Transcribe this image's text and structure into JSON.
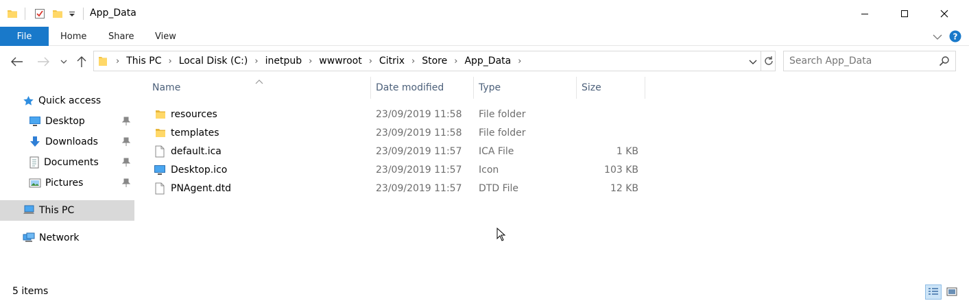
{
  "window": {
    "title": "App_Data",
    "minimize_icon": "minimize-icon",
    "maximize_icon": "maximize-icon",
    "close_icon": "close-icon"
  },
  "ribbon": {
    "tabs": [
      {
        "label": "File"
      },
      {
        "label": "Home"
      },
      {
        "label": "Share"
      },
      {
        "label": "View"
      }
    ]
  },
  "address": {
    "crumbs": [
      "This PC",
      "Local Disk (C:)",
      "inetpub",
      "wwwroot",
      "Citrix",
      "Store",
      "App_Data"
    ]
  },
  "search": {
    "placeholder": "Search App_Data"
  },
  "sidebar": {
    "items": [
      {
        "label": "Quick access"
      },
      {
        "label": "Desktop"
      },
      {
        "label": "Downloads"
      },
      {
        "label": "Documents"
      },
      {
        "label": "Pictures"
      },
      {
        "label": "This PC"
      },
      {
        "label": "Network"
      }
    ]
  },
  "columns": {
    "name": "Name",
    "date": "Date modified",
    "type": "Type",
    "size": "Size"
  },
  "files": [
    {
      "name": "resources",
      "date": "23/09/2019 11:58",
      "type": "File folder",
      "size": "",
      "icon": "folder-icon"
    },
    {
      "name": "templates",
      "date": "23/09/2019 11:58",
      "type": "File folder",
      "size": "",
      "icon": "folder-icon"
    },
    {
      "name": "default.ica",
      "date": "23/09/2019 11:57",
      "type": "ICA File",
      "size": "1 KB",
      "icon": "file-icon"
    },
    {
      "name": "Desktop.ico",
      "date": "23/09/2019 11:57",
      "type": "Icon",
      "size": "103 KB",
      "icon": "monitor-icon"
    },
    {
      "name": "PNAgent.dtd",
      "date": "23/09/2019 11:57",
      "type": "DTD File",
      "size": "12 KB",
      "icon": "file-icon"
    }
  ],
  "status": {
    "count": "5 items"
  },
  "colors": {
    "accent": "#1979ca",
    "folder": "#f3c447",
    "selected": "#d9d9d9",
    "header_text": "#4c607a"
  }
}
